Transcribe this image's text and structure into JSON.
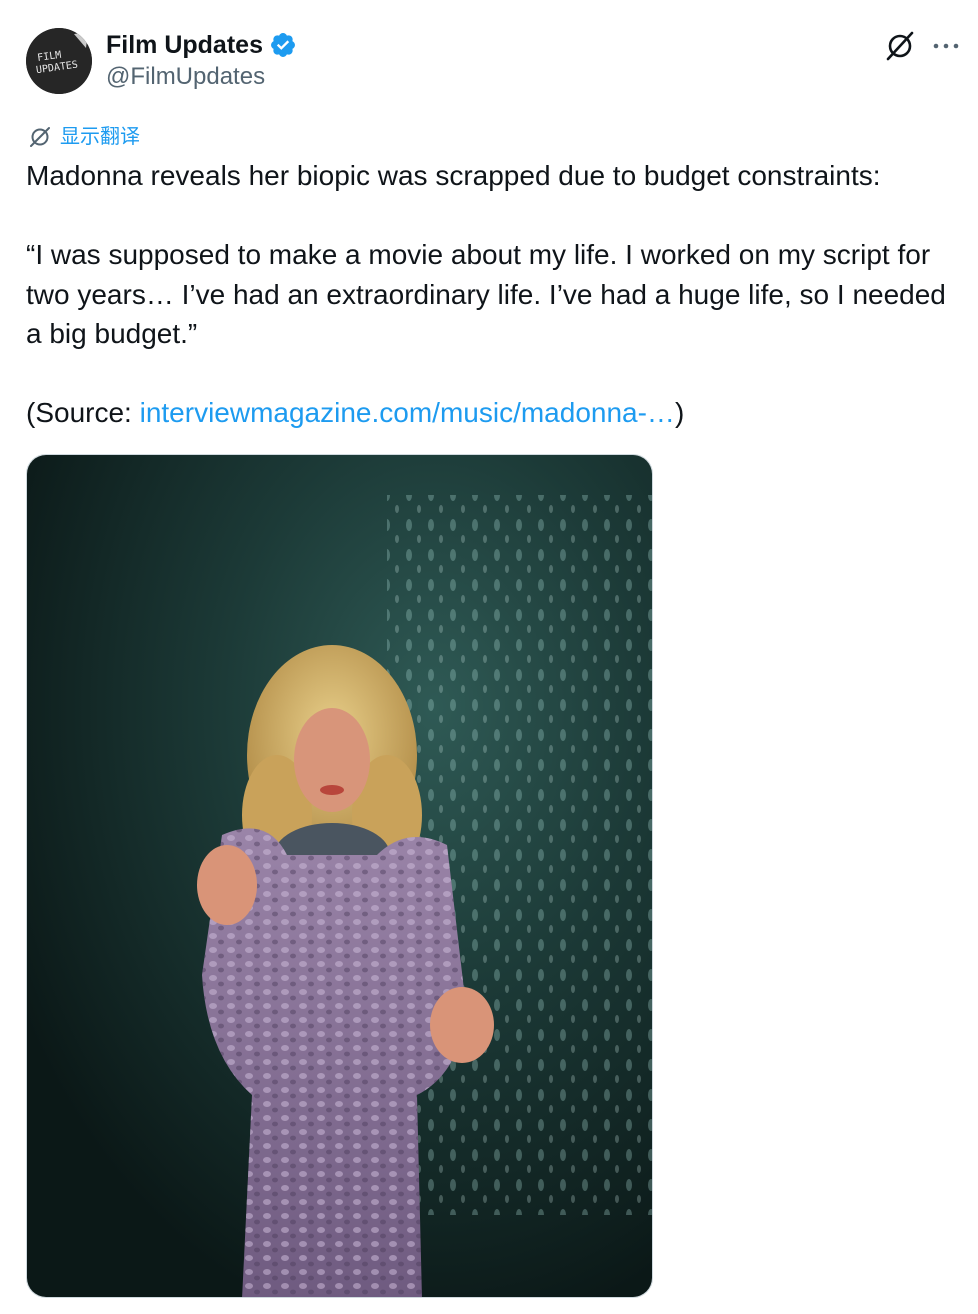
{
  "author": {
    "display_name": "Film Updates",
    "handle": "@FilmUpdates",
    "avatar_text_line1": "FILM",
    "avatar_text_line2": "UPDATES",
    "verified_color": "#1d9bf0"
  },
  "actions": {
    "grok_icon": "grok-icon",
    "more_icon": "more-icon"
  },
  "translate": {
    "label": "显示翻译",
    "icon": "translate-icon"
  },
  "tweet": {
    "line1": "Madonna reveals her biopic was scrapped due to budget constraints:",
    "quote": "“I was supposed to make a movie about my life. I worked on my script for two years… I’ve had an extraordinary life. I’ve had a huge life, so I needed a big budget.”",
    "source_prefix": "(Source: ",
    "source_link": "interviewmagazine.com/music/madonna-…",
    "source_suffix": ")"
  },
  "colors": {
    "text": "#0f1419",
    "secondary": "#536471",
    "link": "#1d9bf0"
  }
}
